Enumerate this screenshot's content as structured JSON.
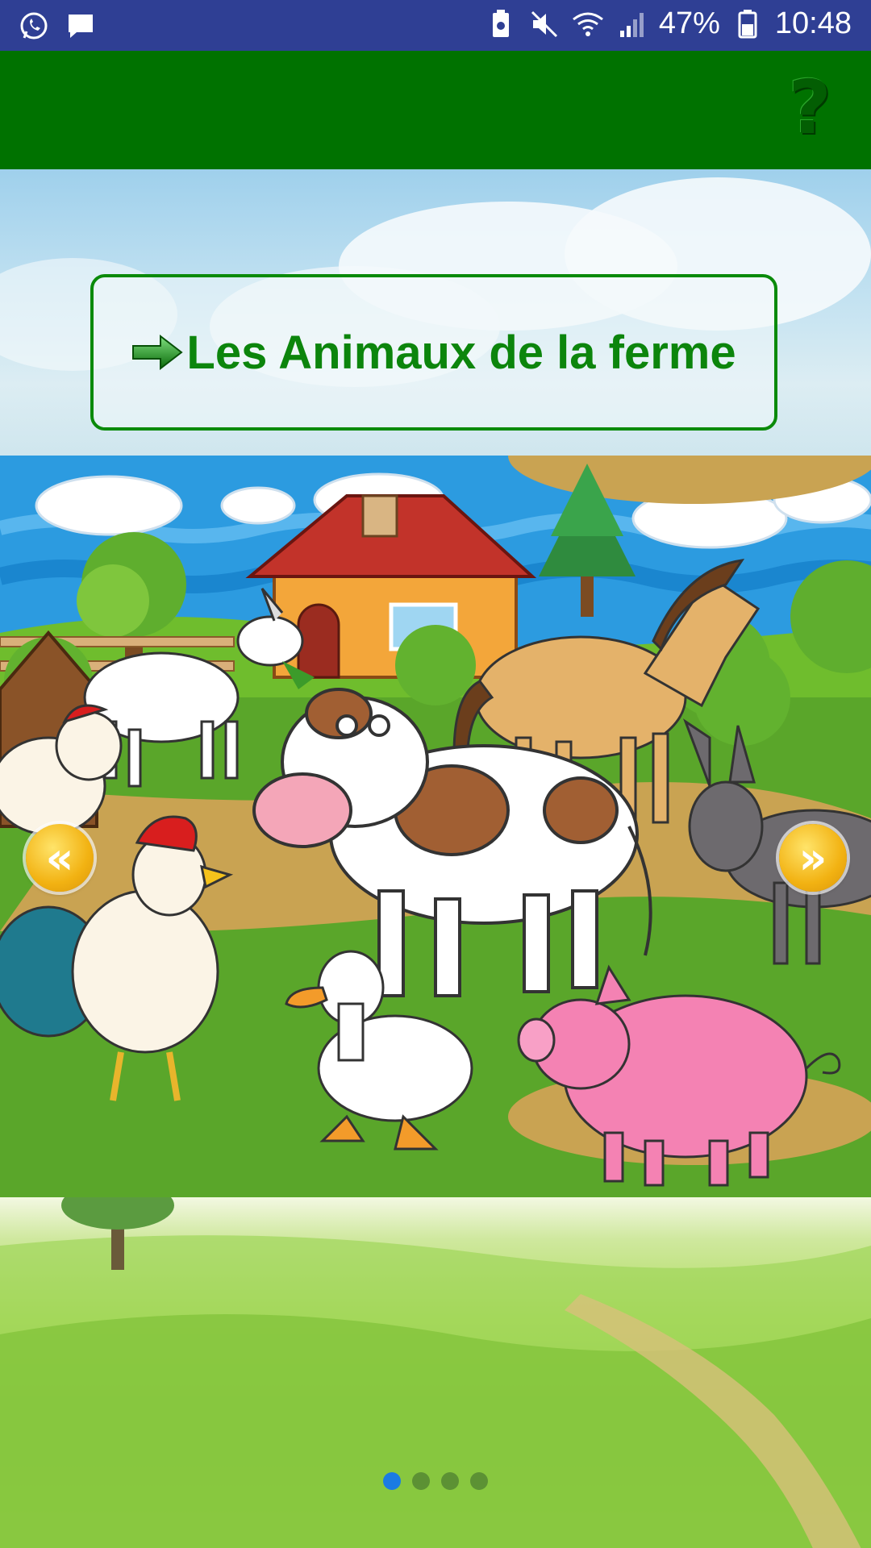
{
  "statusbar": {
    "battery": "47%",
    "time": "10:48",
    "icons_left": [
      "whatsapp-icon",
      "message-icon"
    ],
    "icons_right": [
      "battery-saver-icon",
      "mute-icon",
      "wifi-icon",
      "signal-icon",
      "battery-icon"
    ]
  },
  "toolbar": {
    "bg_color": "#007200",
    "help_icon": "?"
  },
  "banner": {
    "title": "Les Animaux de la ferme",
    "title_color": "#0c850c"
  },
  "carousel": {
    "prev_label": "«",
    "next_label": "»",
    "page_count": 4,
    "active_page": 1
  }
}
